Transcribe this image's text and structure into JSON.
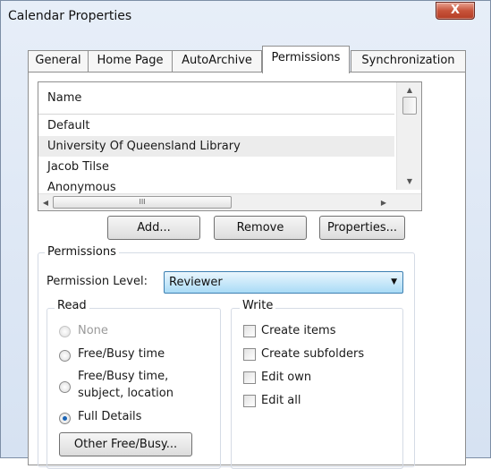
{
  "window": {
    "title": "Calendar Properties",
    "close_glyph": "X"
  },
  "tabs": [
    {
      "label": "General",
      "active": false
    },
    {
      "label": "Home Page",
      "active": false
    },
    {
      "label": "AutoArchive",
      "active": false
    },
    {
      "label": "Permissions",
      "active": true
    },
    {
      "label": "Synchronization",
      "active": false
    }
  ],
  "user_list": {
    "column_header": "Name",
    "rows": [
      "Default",
      "University Of Queensland Library",
      "Jacob Tilse",
      "Anonymous"
    ],
    "selected_row": 1,
    "scroll_thumb_grip": "III"
  },
  "buttons": {
    "add": "Add...",
    "remove": "Remove",
    "properties": "Properties..."
  },
  "permissions": {
    "legend": "Permissions",
    "level_label": "Permission Level:",
    "level_value": "Reviewer",
    "read": {
      "legend": "Read",
      "options": [
        {
          "label": "None",
          "checked": false,
          "disabled": true
        },
        {
          "label": "Free/Busy time",
          "checked": false,
          "disabled": false
        },
        {
          "label_line1": "Free/Busy time,",
          "label_line2": "subject, location",
          "checked": false,
          "disabled": false
        },
        {
          "label": "Full Details",
          "checked": true,
          "disabled": false
        }
      ],
      "other_button": "Other Free/Busy..."
    },
    "write": {
      "legend": "Write",
      "options": [
        {
          "label": "Create items",
          "checked": false
        },
        {
          "label": "Create subfolders",
          "checked": false
        },
        {
          "label": "Edit own",
          "checked": false
        },
        {
          "label": "Edit all",
          "checked": false
        }
      ]
    }
  },
  "colors": {
    "dropdown_border": "#3c7fb1",
    "dropdown_fill": "#a9dbf6",
    "selected_row": "#ececec",
    "close_button": "#c7533a",
    "radio_dot": "#1a64b5"
  }
}
